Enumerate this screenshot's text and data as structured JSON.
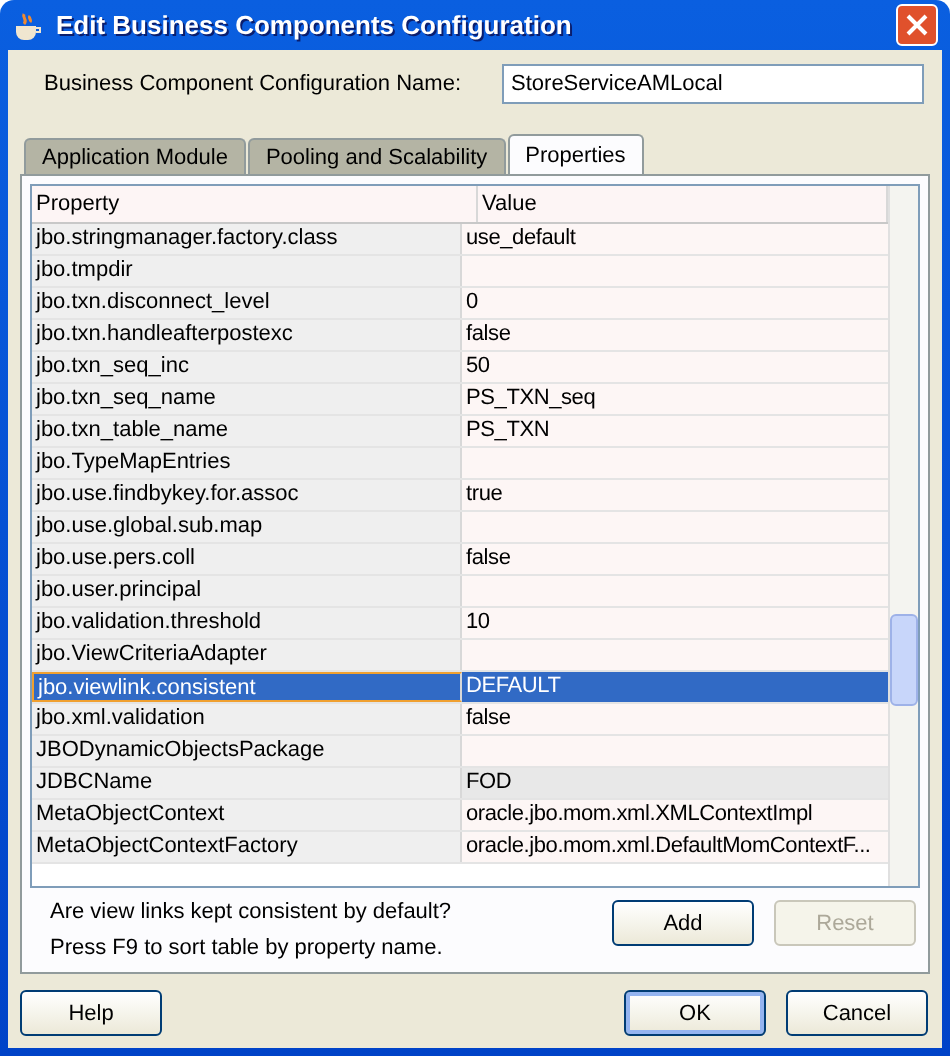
{
  "window": {
    "title": "Edit Business Components Configuration"
  },
  "config_name": {
    "label": "Business Component Configuration Name:",
    "value": "StoreServiceAMLocal"
  },
  "tabs": [
    {
      "label": "Application Module",
      "selected": false
    },
    {
      "label": "Pooling and Scalability",
      "selected": false
    },
    {
      "label": "Properties",
      "selected": true
    }
  ],
  "table": {
    "columns": [
      "Property",
      "Value"
    ],
    "rows": [
      {
        "property": "jbo.stringmanager.factory.class",
        "value": "use_default",
        "selected": false,
        "shaded": false
      },
      {
        "property": "jbo.tmpdir",
        "value": "",
        "selected": false,
        "shaded": false
      },
      {
        "property": "jbo.txn.disconnect_level",
        "value": "0",
        "selected": false,
        "shaded": false
      },
      {
        "property": "jbo.txn.handleafterpostexc",
        "value": "false",
        "selected": false,
        "shaded": false
      },
      {
        "property": "jbo.txn_seq_inc",
        "value": "50",
        "selected": false,
        "shaded": false
      },
      {
        "property": "jbo.txn_seq_name",
        "value": "PS_TXN_seq",
        "selected": false,
        "shaded": false
      },
      {
        "property": "jbo.txn_table_name",
        "value": "PS_TXN",
        "selected": false,
        "shaded": false
      },
      {
        "property": "jbo.TypeMapEntries",
        "value": "",
        "selected": false,
        "shaded": false
      },
      {
        "property": "jbo.use.findbykey.for.assoc",
        "value": "true",
        "selected": false,
        "shaded": false
      },
      {
        "property": "jbo.use.global.sub.map",
        "value": "",
        "selected": false,
        "shaded": false
      },
      {
        "property": "jbo.use.pers.coll",
        "value": "false",
        "selected": false,
        "shaded": false
      },
      {
        "property": "jbo.user.principal",
        "value": "",
        "selected": false,
        "shaded": false
      },
      {
        "property": "jbo.validation.threshold",
        "value": "10",
        "selected": false,
        "shaded": false
      },
      {
        "property": "jbo.ViewCriteriaAdapter",
        "value": "",
        "selected": false,
        "shaded": false
      },
      {
        "property": "jbo.viewlink.consistent",
        "value": "DEFAULT",
        "selected": true,
        "shaded": false
      },
      {
        "property": "jbo.xml.validation",
        "value": "false",
        "selected": false,
        "shaded": false
      },
      {
        "property": "JBODynamicObjectsPackage",
        "value": "",
        "selected": false,
        "shaded": false
      },
      {
        "property": "JDBCName",
        "value": "FOD",
        "selected": false,
        "shaded": true
      },
      {
        "property": "MetaObjectContext",
        "value": "oracle.jbo.mom.xml.XMLContextImpl",
        "selected": false,
        "shaded": false
      },
      {
        "property": "MetaObjectContextFactory",
        "value": "oracle.jbo.mom.xml.DefaultMomContextF...",
        "selected": false,
        "shaded": false
      }
    ]
  },
  "description": "Are view links kept consistent by default?",
  "hint": "Press F9 to sort table by property name.",
  "table_buttons": [
    {
      "label": "Add",
      "disabled": false
    },
    {
      "label": "Reset",
      "disabled": true
    }
  ],
  "help_button": "Help",
  "dialog_buttons": [
    {
      "label": "OK",
      "default": true
    },
    {
      "label": "Cancel",
      "default": false
    }
  ]
}
